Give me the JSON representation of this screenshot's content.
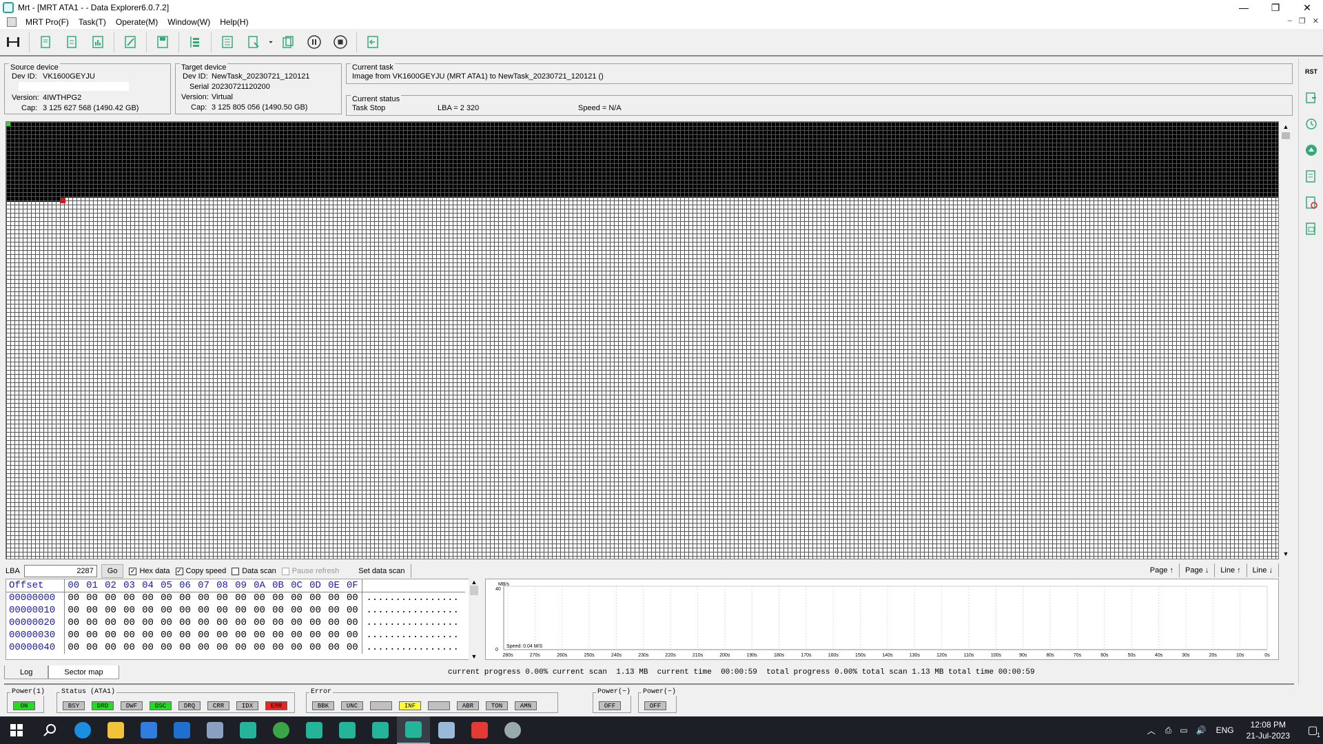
{
  "window": {
    "title": "Mrt - [MRT ATA1 -  - Data Explorer6.0.7.2]",
    "min": "—",
    "max": "❐",
    "close": "✕"
  },
  "menu": {
    "items": [
      "MRT Pro(F)",
      "Task(T)",
      "Operate(M)",
      "Window(W)",
      "Help(H)"
    ],
    "mdi_buttons": [
      "–",
      "❐",
      "✕"
    ]
  },
  "toolbar": {
    "icons": [
      "connect-icon",
      "new-task-icon",
      "open-task-icon",
      "statistics-icon",
      "edit-icon",
      "save-icon",
      "tree-icon",
      "task-list-icon",
      "export-icon",
      "dropdown-icon",
      "copy-icon",
      "pause-icon",
      "stop-icon",
      "exit-icon"
    ]
  },
  "rightbar": {
    "rst_label": "RST"
  },
  "source": {
    "caption": "Source device",
    "dev_id_label": "Dev ID:",
    "dev_id": "VK1600GEYJU",
    "version_label": "Version:",
    "version": "4IWTHPG2",
    "cap_label": "Cap:",
    "cap": "3 125 627 568 (1490.42 GB)"
  },
  "target": {
    "caption": "Target device",
    "dev_id_label": "Dev ID:",
    "dev_id": "NewTask_20230721_120121",
    "serial_label": "Serial",
    "serial": "20230721120200",
    "version_label": "Version:",
    "version": "Virtual",
    "cap_label": "Cap:",
    "cap": "3 125 805 056 (1490.50 GB)"
  },
  "task": {
    "caption": "Current task",
    "text": "Image from VK1600GEYJU (MRT ATA1) to NewTask_20230721_120121 ()"
  },
  "status": {
    "caption": "Current status",
    "state": "Task Stop",
    "lba": "LBA = 2 320",
    "speed": "Speed = N/A"
  },
  "sector_map": {
    "progress_fraction": 0.0074
  },
  "lba_row": {
    "label": "LBA",
    "value": "2287",
    "go": "Go",
    "hex_data": "Hex data",
    "copy_speed": "Copy speed",
    "data_scan": "Data scan",
    "pause_refresh": "Pause refresh",
    "set_data_scan": "Set data scan",
    "page_up": "Page ↑",
    "page_down": "Page ↓",
    "line_up": "Line ↑",
    "line_down": "Line ↓"
  },
  "hex": {
    "offset_label": "Offset",
    "columns": [
      "00",
      "01",
      "02",
      "03",
      "04",
      "05",
      "06",
      "07",
      "08",
      "09",
      "0A",
      "0B",
      "0C",
      "0D",
      "0E",
      "0F"
    ],
    "rows": [
      {
        "offset": "00000000",
        "bytes": [
          "00",
          "00",
          "00",
          "00",
          "00",
          "00",
          "00",
          "00",
          "00",
          "00",
          "00",
          "00",
          "00",
          "00",
          "00",
          "00"
        ],
        "ascii": "................"
      },
      {
        "offset": "00000010",
        "bytes": [
          "00",
          "00",
          "00",
          "00",
          "00",
          "00",
          "00",
          "00",
          "00",
          "00",
          "00",
          "00",
          "00",
          "00",
          "00",
          "00"
        ],
        "ascii": "................"
      },
      {
        "offset": "00000020",
        "bytes": [
          "00",
          "00",
          "00",
          "00",
          "00",
          "00",
          "00",
          "00",
          "00",
          "00",
          "00",
          "00",
          "00",
          "00",
          "00",
          "00"
        ],
        "ascii": "................"
      },
      {
        "offset": "00000030",
        "bytes": [
          "00",
          "00",
          "00",
          "00",
          "00",
          "00",
          "00",
          "00",
          "00",
          "00",
          "00",
          "00",
          "00",
          "00",
          "00",
          "00"
        ],
        "ascii": "................"
      },
      {
        "offset": "00000040",
        "bytes": [
          "00",
          "00",
          "00",
          "00",
          "00",
          "00",
          "00",
          "00",
          "00",
          "00",
          "00",
          "00",
          "00",
          "00",
          "00",
          "00"
        ],
        "ascii": "................"
      }
    ]
  },
  "speed_chart": {
    "unit": "MB/s",
    "ymax": "40",
    "ymin": "0",
    "speed_text": "Speed: 0.04 M/S",
    "ticks": [
      "280s",
      "270s",
      "260s",
      "250s",
      "240s",
      "230s",
      "220s",
      "210s",
      "200s",
      "190s",
      "180s",
      "170s",
      "160s",
      "150s",
      "140s",
      "130s",
      "120s",
      "110s",
      "100s",
      "90s",
      "80s",
      "70s",
      "60s",
      "50s",
      "40s",
      "30s",
      "20s",
      "10s",
      "0s"
    ]
  },
  "tabs": [
    "Log",
    "Sector map"
  ],
  "progress": {
    "text": "current progress 0.00% current scan  1.13 MB  current time  00:00:59  total progress 0.00% total scan 1.13 MB total time 00:00:59"
  },
  "statusbar": {
    "power1": {
      "caption": "Power(1)",
      "leds": [
        {
          "label": "ON",
          "color": "green"
        }
      ]
    },
    "status": {
      "caption": "Status (ATA1)",
      "leds": [
        {
          "label": "BSY",
          "color": "gray"
        },
        {
          "label": "DRD",
          "color": "green"
        },
        {
          "label": "DWF",
          "color": "gray"
        },
        {
          "label": "DSC",
          "color": "green"
        },
        {
          "label": "DRQ",
          "color": "gray"
        },
        {
          "label": "CRR",
          "color": "gray"
        },
        {
          "label": "IDX",
          "color": "gray"
        },
        {
          "label": "ERR",
          "color": "red"
        }
      ]
    },
    "error": {
      "caption": "Error",
      "leds": [
        {
          "label": "BBK",
          "color": "gray"
        },
        {
          "label": "UNC",
          "color": "gray"
        },
        {
          "label": "",
          "color": "gray"
        },
        {
          "label": "INF",
          "color": "yellow"
        },
        {
          "label": "",
          "color": "gray"
        },
        {
          "label": "ABR",
          "color": "gray"
        },
        {
          "label": "TON",
          "color": "gray"
        },
        {
          "label": "AMN",
          "color": "gray"
        }
      ]
    },
    "power_a": {
      "caption": "Power(−)",
      "leds": [
        {
          "label": "OFF",
          "color": "gray"
        }
      ]
    },
    "power_b": {
      "caption": "Power(−)",
      "leds": [
        {
          "label": "OFF",
          "color": "gray"
        }
      ]
    }
  },
  "taskbar": {
    "lang": "ENG",
    "time": "12:08 PM",
    "date": "21-Jul-2023",
    "notif": "1"
  }
}
